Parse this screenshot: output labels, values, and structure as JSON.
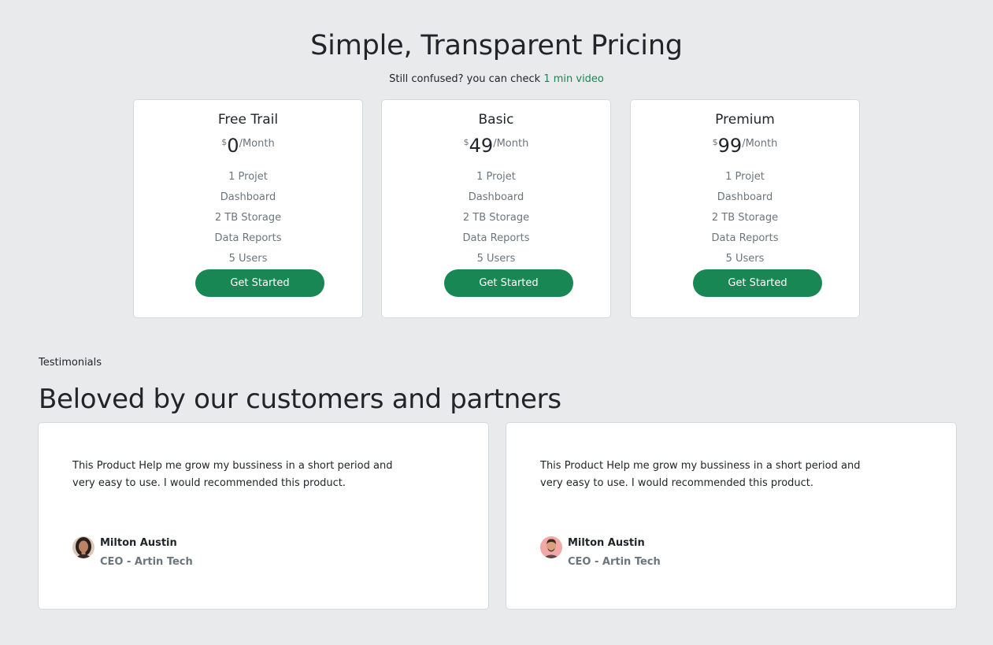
{
  "pricing": {
    "title": "Simple, Transparent Pricing",
    "subtitle_text": "Still confused? you can check ",
    "subtitle_link": "1 min video",
    "plans": [
      {
        "name": "Free Trail",
        "currency": "$",
        "amount": "0",
        "period": "/Month",
        "features": [
          "1 Projet",
          "Dashboard",
          "2 TB Storage",
          "Data Reports",
          "5 Users"
        ],
        "button": "Get Started"
      },
      {
        "name": "Basic",
        "currency": "$",
        "amount": "49",
        "period": "/Month",
        "features": [
          "1 Projet",
          "Dashboard",
          "2 TB Storage",
          "Data Reports",
          "5 Users"
        ],
        "button": "Get Started"
      },
      {
        "name": "Premium",
        "currency": "$",
        "amount": "99",
        "period": "/Month",
        "features": [
          "1 Projet",
          "Dashboard",
          "2 TB Storage",
          "Data Reports",
          "5 Users"
        ],
        "button": "Get Started"
      }
    ]
  },
  "testimonials": {
    "eyebrow": "Testimonials",
    "title": "Beloved by our customers and partners",
    "items": [
      {
        "quote": "This Product Help me grow my bussiness in a short period and very easy to use. I would recommended this product.",
        "name": "Milton Austin",
        "role": "CEO - Artin Tech",
        "avatar": "woman-avatar"
      },
      {
        "quote": "This Product Help me grow my bussiness in a short period and very easy to use. I would recommended this product.",
        "name": "Milton Austin",
        "role": "CEO - Artin Tech",
        "avatar": "man-avatar"
      }
    ]
  },
  "colors": {
    "background": "#e9eaec",
    "accent": "#198754",
    "muted_text": "#6c757d"
  }
}
